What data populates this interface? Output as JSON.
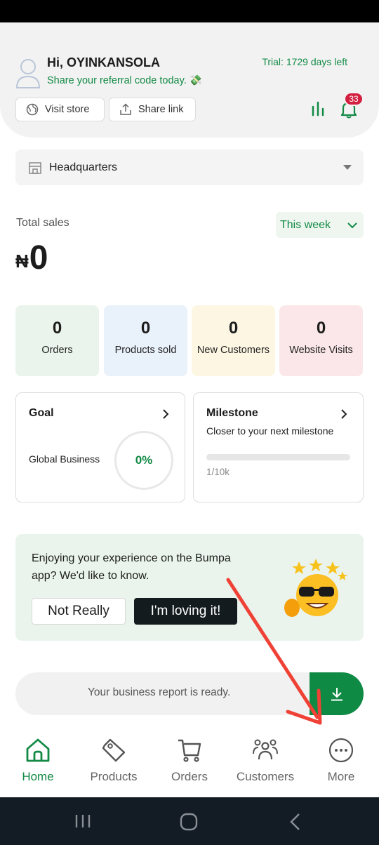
{
  "header": {
    "greeting": "Hi, OYINKANSOLA",
    "referral": "Share your referral code today. 💸",
    "trial": "Trial: 1729 days left",
    "visit_store": "Visit store",
    "share_link": "Share link",
    "notification_count": "33"
  },
  "location": {
    "name": "Headquarters"
  },
  "sales": {
    "label": "Total sales",
    "period": "This week",
    "currency": "₦",
    "amount": "0"
  },
  "metrics": [
    {
      "value": "0",
      "label": "Orders"
    },
    {
      "value": "0",
      "label": "Products sold"
    },
    {
      "value": "0",
      "label": "New Customers"
    },
    {
      "value": "0",
      "label": "Website Visits"
    }
  ],
  "goal": {
    "title": "Goal",
    "name": "Global Business",
    "percent": "0%"
  },
  "milestone": {
    "title": "Milestone",
    "subtitle": "Closer to your next milestone",
    "progress_text": "1/10k",
    "progress_fraction": 0
  },
  "feedback": {
    "question": "Enjoying your experience on the Bumpa app? We'd like to know.",
    "no_label": "Not Really",
    "yes_label": "I'm loving it!"
  },
  "report": {
    "text": "Your business report is ready."
  },
  "nav": [
    {
      "label": "Home",
      "icon": "home-icon",
      "active": true
    },
    {
      "label": "Products",
      "icon": "tag-icon",
      "active": false
    },
    {
      "label": "Orders",
      "icon": "cart-icon",
      "active": false
    },
    {
      "label": "Customers",
      "icon": "people-icon",
      "active": false
    },
    {
      "label": "More",
      "icon": "more-icon",
      "active": false
    }
  ],
  "colors": {
    "brand_green": "#128a45",
    "badge_red": "#d42040",
    "annotation_arrow": "#ef4135"
  }
}
